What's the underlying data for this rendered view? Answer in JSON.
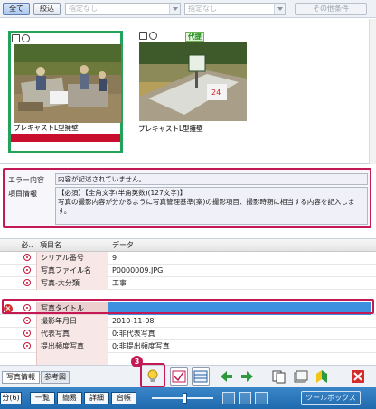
{
  "filter_bar": {
    "all_label": "全て",
    "narrow_label": "絞込",
    "combo1": "指定なし",
    "combo2": "指定なし",
    "other_conditions": "その他条件"
  },
  "thumbnails": [
    {
      "caption": "プレキャストL型擁壁",
      "selected": true,
      "required_badge": ""
    },
    {
      "caption": "プレキャストL型擁壁",
      "selected": false,
      "required_badge": "代提"
    }
  ],
  "info": {
    "error_label": "エラー内容",
    "error_text": "内容が記述されていません。",
    "item_label": "項目情報",
    "item_line1": "【必須】【全角文字(半角英数)(127文字)】",
    "item_line2": "写真の撮影内容が分かるように写真管理基準(案)の撮影項目、撮影時期に相当する内容を記入します。"
  },
  "grid": {
    "headers": {
      "req": "必..",
      "name": "項目名",
      "value": "データ"
    },
    "rows": [
      {
        "name": "シリアル番号",
        "value": "9"
      },
      {
        "name": "写真ファイル名",
        "value": "P0000009.JPG"
      },
      {
        "name": "写真-大分類",
        "value": "工事"
      },
      {
        "name": "写真タイトル",
        "value": ""
      },
      {
        "name": "撮影年月日",
        "value": "2010-11-08"
      },
      {
        "name": "代表写真",
        "value": "0:非代表写真"
      },
      {
        "name": "提出頻度写真",
        "value": "0:非提出頻度写真"
      }
    ]
  },
  "tabs": {
    "photo_info": "写真情報",
    "reference": "参考図"
  },
  "step_number": "3",
  "status_bar": {
    "left_label": "分(6)",
    "list": "一覧",
    "simple": "簡易",
    "detail": "詳細",
    "ledger": "台帳",
    "toolbox": "ツールボックス"
  },
  "colors": {
    "highlight_frame": "#c31a55",
    "selected_cell": "#3d8fe0",
    "status_bar": "#2b78bd",
    "thumb_selected": "#23a35a"
  }
}
